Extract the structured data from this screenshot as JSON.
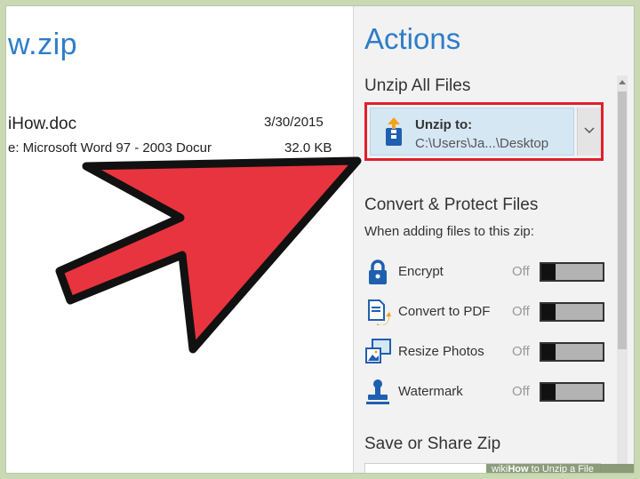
{
  "left": {
    "zip_title": "w.zip",
    "file_name": "iHow.doc",
    "file_date": "3/30/2015",
    "file_type": "e: Microsoft Word 97 - 2003 Docur",
    "file_size": "32.0 KB"
  },
  "actions": {
    "title": "Actions",
    "unzip_section": "Unzip All Files",
    "unzip_label": "Unzip to:",
    "unzip_path": "C:\\Users\\Ja...\\Desktop",
    "convert_section": "Convert & Protect Files",
    "convert_sub": "When adding files to this zip:",
    "options": [
      {
        "label": "Encrypt",
        "state": "Off",
        "icon": "lock-icon"
      },
      {
        "label": "Convert to PDF",
        "state": "Off",
        "icon": "pdf-convert-icon"
      },
      {
        "label": "Resize Photos",
        "state": "Off",
        "icon": "resize-photos-icon"
      },
      {
        "label": "Watermark",
        "state": "Off",
        "icon": "watermark-stamp-icon"
      }
    ],
    "save_section": "Save or Share Zip"
  },
  "watermark": {
    "prefix": "wiki",
    "bold": "How",
    "rest": " to Unzip a File"
  },
  "colors": {
    "accent_blue": "#2e7dc8",
    "highlight_red": "#e0202a",
    "arrow_red": "#e8343f"
  }
}
